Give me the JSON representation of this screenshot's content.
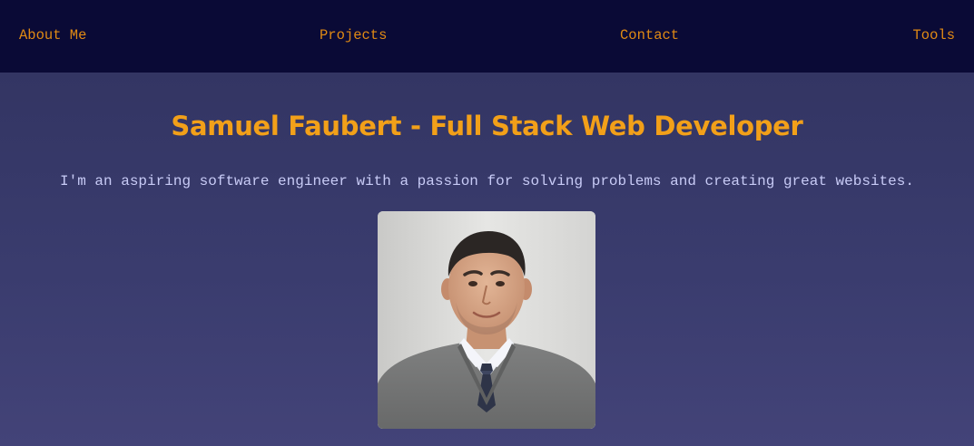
{
  "nav": {
    "items": [
      {
        "label": "About Me"
      },
      {
        "label": "Projects"
      },
      {
        "label": "Contact"
      },
      {
        "label": "Tools"
      }
    ]
  },
  "hero": {
    "title": "Samuel Faubert - Full Stack Web Developer",
    "subtitle": "I'm an aspiring software engineer with a passion for solving problems and creating great websites."
  },
  "colors": {
    "navbar_bg": "#0a0a36",
    "nav_link": "#e08a14",
    "title": "#f2a019",
    "subtitle": "#c8cbf6",
    "page_bg": "#3a3c6e"
  },
  "portrait": {
    "icon": "profile-photo"
  }
}
